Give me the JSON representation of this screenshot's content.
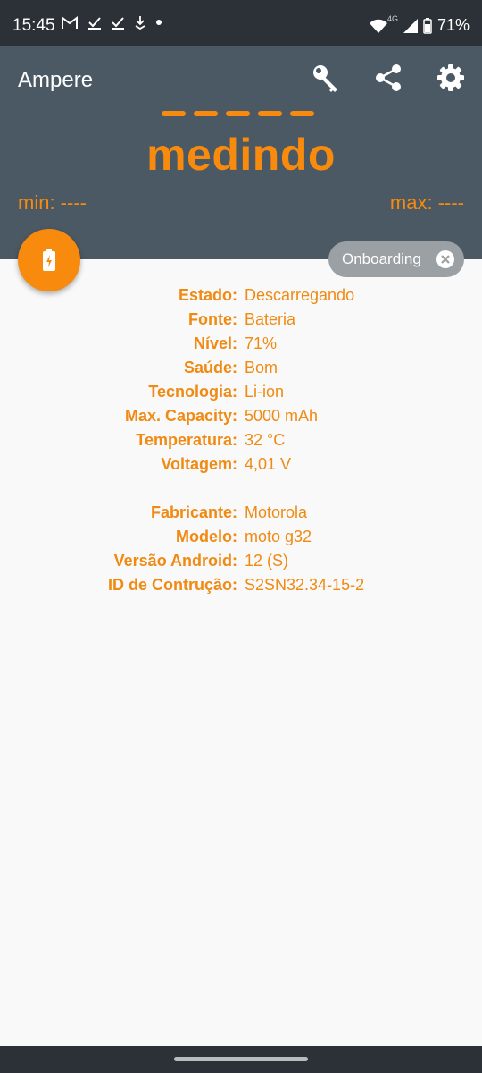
{
  "status_bar": {
    "time": "15:45",
    "network": "4G",
    "battery": "71%",
    "icons": [
      "gmail-icon",
      "check-icon",
      "check-icon",
      "download-icon",
      "dot-icon",
      "wifi-icon",
      "signal-icon",
      "battery-icon"
    ]
  },
  "app": {
    "title": "Ampere",
    "measuring_text": "medindo",
    "min_label": "min: ----",
    "max_label": "max: ----",
    "toolbar_icons": [
      "key-icon",
      "share-icon",
      "gear-icon"
    ]
  },
  "chip": {
    "label": "Onboarding"
  },
  "battery_info": [
    {
      "label": "Estado:",
      "value": "Descarregando"
    },
    {
      "label": "Fonte:",
      "value": "Bateria"
    },
    {
      "label": "Nível:",
      "value": "71%"
    },
    {
      "label": "Saúde:",
      "value": "Bom"
    },
    {
      "label": "Tecnologia:",
      "value": "Li-ion"
    },
    {
      "label": "Max. Capacity:",
      "value": "5000 mAh"
    },
    {
      "label": "Temperatura:",
      "value": "32 °C"
    },
    {
      "label": "Voltagem:",
      "value": "4,01 V"
    }
  ],
  "device_info": [
    {
      "label": "Fabricante:",
      "value": "Motorola"
    },
    {
      "label": "Modelo:",
      "value": "moto g32"
    },
    {
      "label": "Versão Android:",
      "value": "12 (S)"
    },
    {
      "label": "ID de Contrução:",
      "value": "S2SN32.34-15-2"
    }
  ],
  "colors": {
    "accent": "#f88a0e",
    "header": "#4a5963",
    "status_bar": "#2b3136"
  }
}
